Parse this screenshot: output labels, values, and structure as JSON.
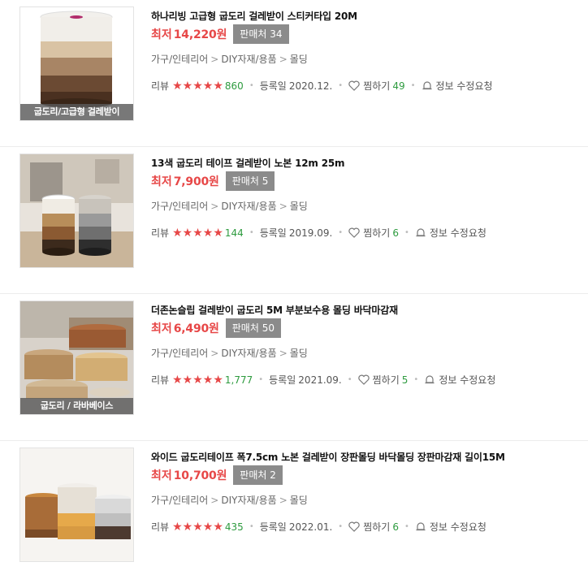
{
  "products": [
    {
      "title": "하나리빙 고급형 굽도리 걸레받이 스티커타입 20M",
      "price_label": "최저",
      "price": "14,220원",
      "seller_label": "판매처",
      "seller_count": "34",
      "categories": [
        "가구/인테리어",
        "DIY자재/용품",
        "몰딩"
      ],
      "review_label": "리뷰",
      "review_count": "860",
      "reg_label": "등록일",
      "reg_date": "2020.12.",
      "wish_label": "찜하기",
      "wish_count": "49",
      "report_label": "정보 수정요청",
      "thumb_caption": "굽도리/고급형 걸레받이"
    },
    {
      "title": "13색 굽도리 테이프 걸레받이 노본 12m 25m",
      "price_label": "최저",
      "price": "7,900원",
      "seller_label": "판매처",
      "seller_count": "5",
      "categories": [
        "가구/인테리어",
        "DIY자재/용품",
        "몰딩"
      ],
      "review_label": "리뷰",
      "review_count": "144",
      "reg_label": "등록일",
      "reg_date": "2019.09.",
      "wish_label": "찜하기",
      "wish_count": "6",
      "report_label": "정보 수정요청",
      "thumb_caption": ""
    },
    {
      "title": "더존논슬립 걸레받이 굽도리 5M 부분보수용 몰딩 바닥마감재",
      "price_label": "최저",
      "price": "6,490원",
      "seller_label": "판매처",
      "seller_count": "50",
      "categories": [
        "가구/인테리어",
        "DIY자재/용품",
        "몰딩"
      ],
      "review_label": "리뷰",
      "review_count": "1,777",
      "reg_label": "등록일",
      "reg_date": "2021.09.",
      "wish_label": "찜하기",
      "wish_count": "5",
      "report_label": "정보 수정요청",
      "thumb_caption": "굽도리 / 라바베이스"
    },
    {
      "title": "와이드 굽도리테이프 폭7.5cm 노본 걸레받이 장판몰딩 바닥몰딩 장판마감재 길이15M",
      "price_label": "최저",
      "price": "10,700원",
      "seller_label": "판매처",
      "seller_count": "2",
      "categories": [
        "가구/인테리어",
        "DIY자재/용품",
        "몰딩"
      ],
      "review_label": "리뷰",
      "review_count": "435",
      "reg_label": "등록일",
      "reg_date": "2022.01.",
      "wish_label": "찜하기",
      "wish_count": "6",
      "report_label": "정보 수정요청",
      "thumb_caption": ""
    }
  ],
  "colors": {
    "accent": "#e74747",
    "green": "#2e9b3f",
    "badge": "#8b8b8b"
  },
  "rating_stars": 4.5
}
